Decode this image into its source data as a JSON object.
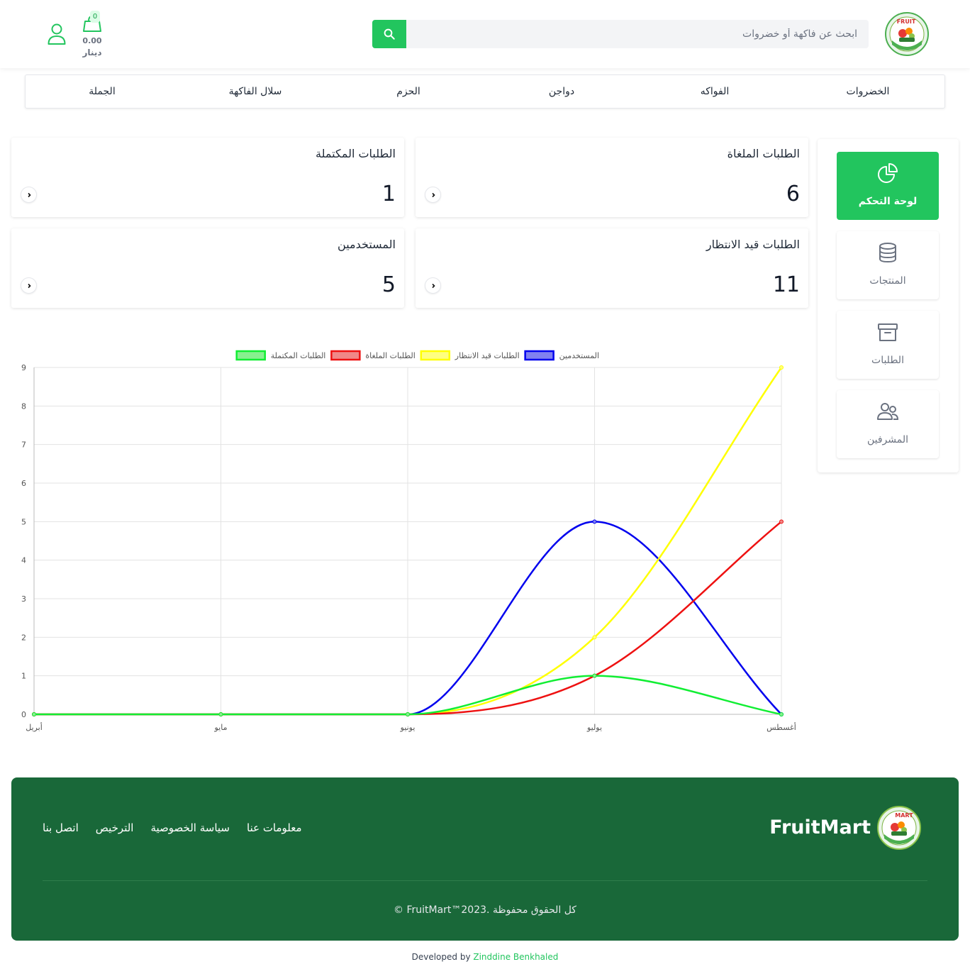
{
  "header": {
    "search_placeholder": "ابحث عن فاكهة أو خضروات",
    "cart_count": "0",
    "cart_total": "0.00",
    "cart_currency": "دينار"
  },
  "categories": [
    "الخضروات",
    "الفواكه",
    "دواجن",
    "الحزم",
    "سلال الفاكهة",
    "الجملة"
  ],
  "sidebar": {
    "items": [
      {
        "label": "لوحة التحكم",
        "icon": "pie-chart-icon",
        "active": true
      },
      {
        "label": "المنتجات",
        "icon": "database-icon",
        "active": false
      },
      {
        "label": "الطلبات",
        "icon": "archive-box-icon",
        "active": false
      },
      {
        "label": "المشرفين",
        "icon": "users-icon",
        "active": false
      }
    ]
  },
  "stats": {
    "cancelled": {
      "title": "الطلبات الملغاة",
      "value": "6"
    },
    "completed": {
      "title": "الطلبات المكتملة",
      "value": "1"
    },
    "pending": {
      "title": "الطلبات قيد الانتظار",
      "value": "11"
    },
    "users": {
      "title": "المستخدمين",
      "value": "5"
    }
  },
  "chart_data": {
    "type": "line",
    "x": [
      "أبريل",
      "مايو",
      "يونيو",
      "يوليو",
      "أغسطس"
    ],
    "ylim": [
      0,
      9
    ],
    "yticks": [
      "0",
      "1",
      "2",
      "3",
      "4",
      "5",
      "6",
      "7",
      "8",
      "9"
    ],
    "grid": true,
    "legend_position": "top",
    "series": [
      {
        "name": "المستخدمين",
        "color": "#0000ee",
        "fill": "#8080f0",
        "values": [
          0,
          0,
          0,
          5,
          0
        ]
      },
      {
        "name": "الطلبات قيد الانتظار",
        "color": "#ffff00",
        "fill": "#ffff80",
        "values": [
          0,
          0,
          0,
          2,
          9
        ]
      },
      {
        "name": "الطلبات الملغاة",
        "color": "#ee1111",
        "fill": "#f08888",
        "values": [
          0,
          0,
          0,
          1,
          5
        ]
      },
      {
        "name": "الطلبات المكتملة",
        "color": "#11ee33",
        "fill": "#88f090",
        "values": [
          0,
          0,
          0,
          1,
          0
        ]
      }
    ]
  },
  "footer": {
    "brand": "FruitMart",
    "links": [
      "اتصل بنا",
      "الترخيص",
      "سياسة الخصوصية",
      "معلومات عنا"
    ],
    "copyright": "© FruitMart™2023. كل الحقوق محفوظة",
    "developed_by": "Developed by",
    "developer": "Zinddine Benkhaled"
  },
  "colors": {
    "accent": "#22c55e",
    "footer_bg": "#196839"
  }
}
